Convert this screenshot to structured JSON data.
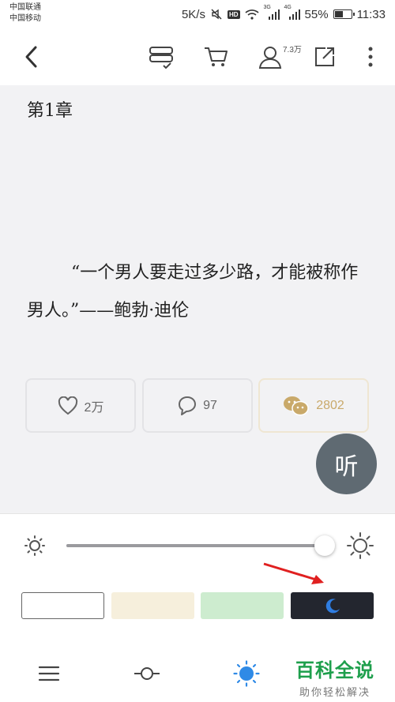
{
  "status_bar": {
    "carrier_1": "中国联通",
    "carrier_2": "中国移动",
    "net_speed": "5K/s",
    "hd_badge": "HD",
    "signal_1_label": "3G",
    "signal_2_label": "4G",
    "battery_percent": "55%",
    "battery_level": 0.55,
    "time": "11:33"
  },
  "toolbar": {
    "back_icon": "chevron-left-icon",
    "follower_count": "7.3万",
    "icons": [
      "bookshelf-icon",
      "cart-icon",
      "user-icon",
      "share-icon",
      "more-icon"
    ]
  },
  "reader": {
    "chapter_title": "第1章",
    "quote": "“一个男人要走过多少路，才能被称作男人。”——鲍勃·迪伦"
  },
  "stats": {
    "likes": "2万",
    "comments": "97",
    "wechat_shares": "2802"
  },
  "listen_button": {
    "label": "听"
  },
  "settings": {
    "brightness_level": 0.985,
    "themes": [
      "white",
      "beige",
      "green",
      "night"
    ],
    "selected_theme": "night",
    "colors": {
      "white": "#ffffff",
      "beige": "#f6efdc",
      "green": "#cdeccf",
      "night": "#23262f",
      "arrow": "#e02020"
    }
  },
  "bottom_nav": {
    "icons": [
      "menu-icon",
      "progress-icon",
      "brightness-icon"
    ]
  },
  "watermark": {
    "main": "百科全说",
    "sub": "助你轻松解决"
  }
}
